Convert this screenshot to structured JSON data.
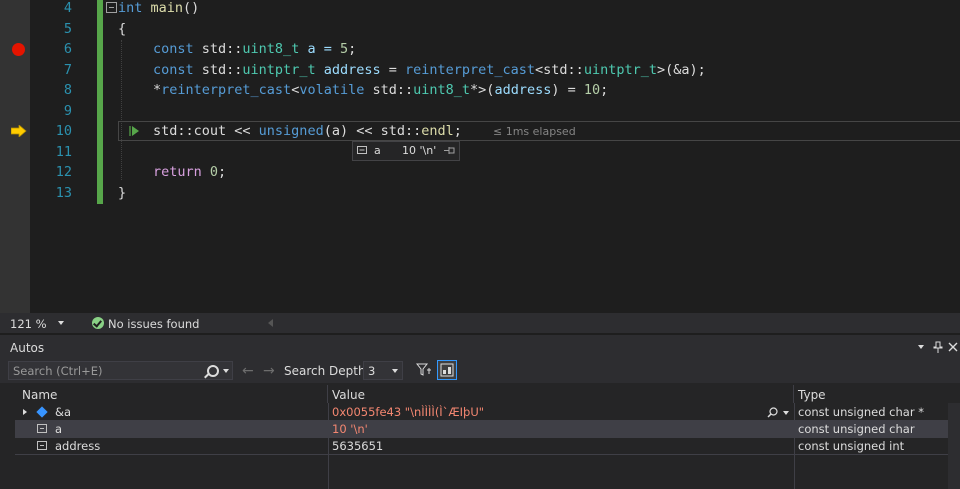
{
  "editor": {
    "line_numbers": [
      "4",
      "5",
      "6",
      "7",
      "8",
      "9",
      "10",
      "11",
      "12",
      "13"
    ],
    "code": {
      "l4_kw": "int",
      "l4_fn": "main",
      "l4_rest": "()",
      "l5": "{",
      "l6_kw": "const",
      "l6_ns": "std::",
      "l6_ty": "uint8_t",
      "l6_rest": " a = ",
      "l6_num": "5",
      "l6_end": ";",
      "l7_kw": "const",
      "l7_ns": "std::",
      "l7_ty": "uintptr_t",
      "l7_var": " address",
      "l7_eq": " = ",
      "l7_cast": "reinterpret_cast",
      "l7_lt": "<std::",
      "l7_ty2": "uintptr_t",
      "l7_end": ">(&a);",
      "l8_star": "*",
      "l8_cast": "reinterpret_cast",
      "l8_lt": "<",
      "l8_kw": "volatile",
      "l8_ns": " std::",
      "l8_ty": "uint8_t",
      "l8_mid": "*>(",
      "l8_var": "address",
      "l8_eq": ") = ",
      "l8_num": "10",
      "l8_end": ";",
      "l10_ns": "std::",
      "l10_fn1": "cout",
      "l10_op": " << ",
      "l10_kw": "unsigned",
      "l10_arg": "(a)",
      "l10_op2": " << std::",
      "l10_fn2": "endl",
      "l10_end": ";",
      "l12_kw": "return",
      "l12_num": " 0",
      "l12_end": ";",
      "l13": "}"
    },
    "elapsed": "≤ 1ms elapsed",
    "datatip": {
      "name": "a",
      "value": "10 '\\n'"
    }
  },
  "status": {
    "zoom": "121 %",
    "issues": "No issues found"
  },
  "autos": {
    "title": "Autos",
    "search_placeholder": "Search (Ctrl+E)",
    "search_depth_label": "Search Depth:",
    "search_depth_value": "3",
    "columns": [
      "Name",
      "Value",
      "Type"
    ],
    "rows": [
      {
        "name": "&a",
        "value": "0x0055fe43 \"\\nÌÌÌÌ(Ì`ÆIþU\"",
        "type": "const unsigned char *"
      },
      {
        "name": "a",
        "value": "10 '\\n'",
        "type": "const unsigned char"
      },
      {
        "name": "address",
        "value": "5635651",
        "type": "const unsigned int"
      }
    ]
  },
  "colors": {
    "accent": "#3399ff",
    "changed_value": "#f48771",
    "breakpoint": "#e51400",
    "change_bar": "#57a64a"
  }
}
